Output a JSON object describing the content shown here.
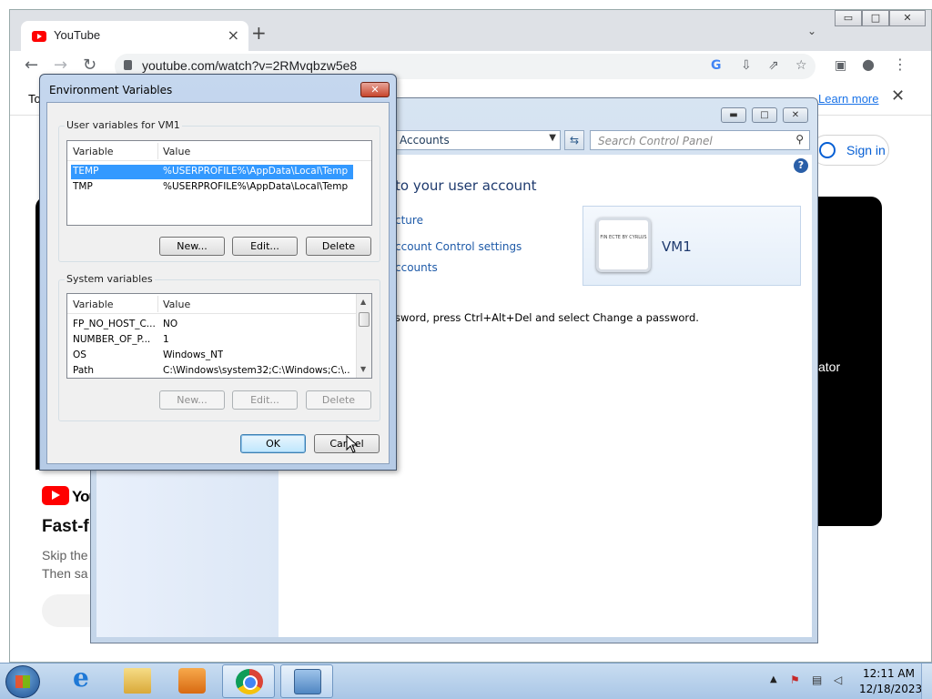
{
  "browser": {
    "tab_title": "YouTube",
    "tab_close": "×",
    "new_tab": "+",
    "tab_search": "⌄",
    "url": "youtube.com/watch?v=2RMvqbzw5e8",
    "nav": {
      "back": "←",
      "forward": "→",
      "reload": "↻"
    },
    "window_controls": {
      "minimize": "▭",
      "maximize": "□",
      "close": "✕"
    },
    "learn_more": "Learn more",
    "bar_close": "✕",
    "bar_prefix": "To",
    "sign_in": "Sign in",
    "video_fragment": "ator",
    "promo": {
      "brand": "You",
      "title": "Fast-f",
      "line1": "Skip the",
      "line2": "Then sa"
    }
  },
  "control_panel": {
    "address": "Accounts",
    "search_placeholder": "Search Control Panel",
    "help": "?",
    "heading": "to your user account",
    "links": [
      "cture",
      "ccount Control settings",
      "ccounts"
    ],
    "user_name": "VM1",
    "avatar_text": "FIN ECTE BY CYRLUS",
    "note": "sword, press Ctrl+Alt+Del and select Change a password."
  },
  "env_dialog": {
    "title": "Environment Variables",
    "close": "✕",
    "user_group_label": "User variables for VM1",
    "system_group_label": "System variables",
    "columns": {
      "variable": "Variable",
      "value": "Value"
    },
    "user_vars": [
      {
        "name": "TEMP",
        "value": "%USERPROFILE%\\AppData\\Local\\Temp"
      },
      {
        "name": "TMP",
        "value": "%USERPROFILE%\\AppData\\Local\\Temp"
      }
    ],
    "system_vars": [
      {
        "name": "FP_NO_HOST_C...",
        "value": "NO"
      },
      {
        "name": "NUMBER_OF_P...",
        "value": "1"
      },
      {
        "name": "OS",
        "value": "Windows_NT"
      },
      {
        "name": "Path",
        "value": "C:\\Windows\\system32;C:\\Windows;C:\\..."
      }
    ],
    "buttons": {
      "new": "New...",
      "edit": "Edit...",
      "delete": "Delete",
      "ok": "OK",
      "cancel": "Cancel"
    }
  },
  "taskbar": {
    "clock_time": "12:11 AM",
    "clock_date": "12/18/2023",
    "tray_arrow": "▲"
  }
}
